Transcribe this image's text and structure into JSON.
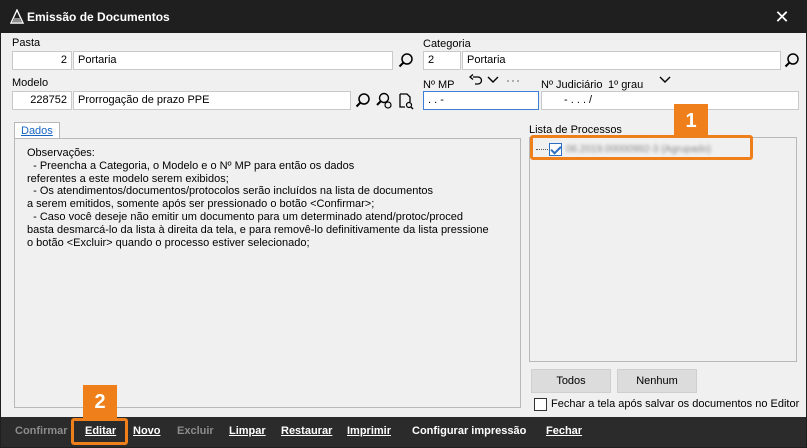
{
  "window": {
    "title": "Emissão de Documentos",
    "close_glyph": "✕"
  },
  "pasta": {
    "label": "Pasta",
    "code": "2",
    "name": "Portaria"
  },
  "categoria": {
    "label": "Categoria",
    "code": "2",
    "name": "Portaria"
  },
  "modelo": {
    "label": "Modelo",
    "code": "228752",
    "name": "Prorrogação de prazo PPE"
  },
  "mp": {
    "label": "Nº MP",
    "value": " .     .        -"
  },
  "judiciario": {
    "label": "Nº Judiciário",
    "grau": "1º grau",
    "value": "-    .      .    .     /"
  },
  "tabs": {
    "dados": "Dados"
  },
  "observacoes": "Observações:\n  - Preencha a Categoria, o Modelo e o Nº MP para então os dados\nreferentes a este modelo serem exibidos;\n  - Os atendimentos/documentos/protocolos serão incluídos na lista de documentos\na serem emitidos, somente após ser pressionado o botão <Confirmar>;\n  - Caso você deseje não emitir um documento para um determinado atend/protoc/proced\nbasta desmarcá-lo da lista à direita da tela, e para removê-lo definitivamente da lista pressione\no botão <Excluir> quando o processo estiver selecionado;",
  "processos": {
    "label": "Lista de Processos",
    "items": [
      {
        "text": "06.2019.00000992-3 (Agrupado)",
        "checked": true
      }
    ]
  },
  "buttons": {
    "todos": "Todos",
    "nenhum": "Nenhum"
  },
  "fechar_checkbox": {
    "label": "Fechar a tela após salvar os documentos no Editor",
    "checked": false
  },
  "callouts": {
    "one": "1",
    "two": "2"
  },
  "bottom": {
    "confirmar": "Confirmar",
    "editar": "Editar",
    "novo": "Novo",
    "excluir": "Excluir",
    "limpar": "Limpar",
    "restaurar": "Restaurar",
    "imprimir": "Imprimir",
    "configurar": "Configurar impressão",
    "fechar": "Fechar"
  },
  "colors": {
    "accent": "#ef7f1a",
    "focus": "#3d7fd6",
    "titlebar": "#1f1f1f",
    "bottombar": "#2b2b2b"
  }
}
